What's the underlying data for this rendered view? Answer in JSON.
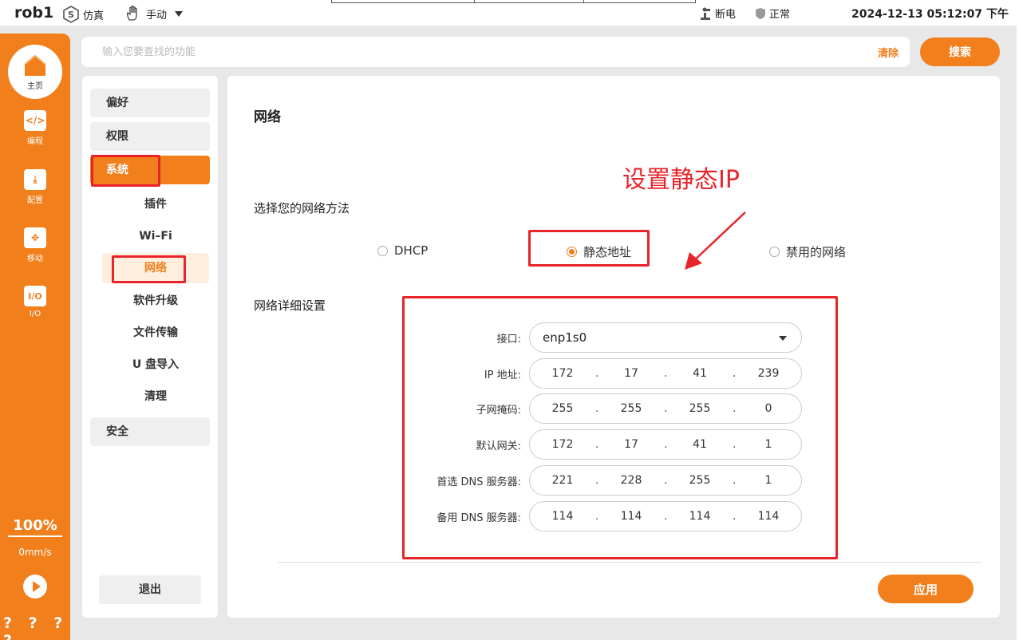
{
  "topbar": {
    "robot_name": "rob1",
    "sim_label": "仿真",
    "mode_label": "手动",
    "power_label": "断电",
    "status_label": "正常",
    "datetime": "2024-12-13 05:12:07 下午"
  },
  "sidebar": {
    "home_label": "主页",
    "items": [
      {
        "label": "编程",
        "icon": "code-icon",
        "glyph": "</>"
      },
      {
        "label": "配置",
        "icon": "download-icon",
        "glyph": "⤓"
      },
      {
        "label": "移动",
        "icon": "move-arrows-icon",
        "glyph": "✥"
      },
      {
        "label": "I/O",
        "icon": "io-icon",
        "glyph": "I/O"
      }
    ],
    "speed_percent": "100%",
    "velocity": "0mm/s",
    "help": "? ? ? ?"
  },
  "search": {
    "placeholder": "输入您要查找的功能",
    "clear_label": "清除",
    "button_label": "搜索"
  },
  "menu": {
    "preferences": "偏好",
    "permissions": "权限",
    "system": "系统",
    "sub": {
      "plugins": "插件",
      "wifi": "Wi–Fi",
      "network": "网络",
      "software_upgrade": "软件升级",
      "file_transfer": "文件传输",
      "usb_import": "U 盘导入",
      "cleanup": "清理"
    },
    "security": "安全",
    "logout": "退出"
  },
  "network": {
    "title": "网络",
    "method_label": "选择您的网络方法",
    "methods": {
      "dhcp": "DHCP",
      "static": "静态地址",
      "disabled": "禁用的网络"
    },
    "selected_method": "static",
    "details_label": "网络详细设置",
    "interface_label": "接口:",
    "interface_value": "enp1s0",
    "ip_label": "IP 地址:",
    "ip": [
      "172",
      "17",
      "41",
      "239"
    ],
    "mask_label": "子网掩码:",
    "mask": [
      "255",
      "255",
      "255",
      "0"
    ],
    "gateway_label": "默认网关:",
    "gateway": [
      "172",
      "17",
      "41",
      "1"
    ],
    "dns1_label": "首选 DNS 服务器:",
    "dns1": [
      "221",
      "228",
      "255",
      "1"
    ],
    "dns2_label": "备用 DNS 服务器:",
    "dns2": [
      "114",
      "114",
      "114",
      "114"
    ],
    "apply_label": "应用"
  },
  "annotation": {
    "text": "设置静态IP",
    "color": "#e8242a"
  },
  "colors": {
    "accent": "#f07f1c",
    "annotation": "#e8242a"
  }
}
